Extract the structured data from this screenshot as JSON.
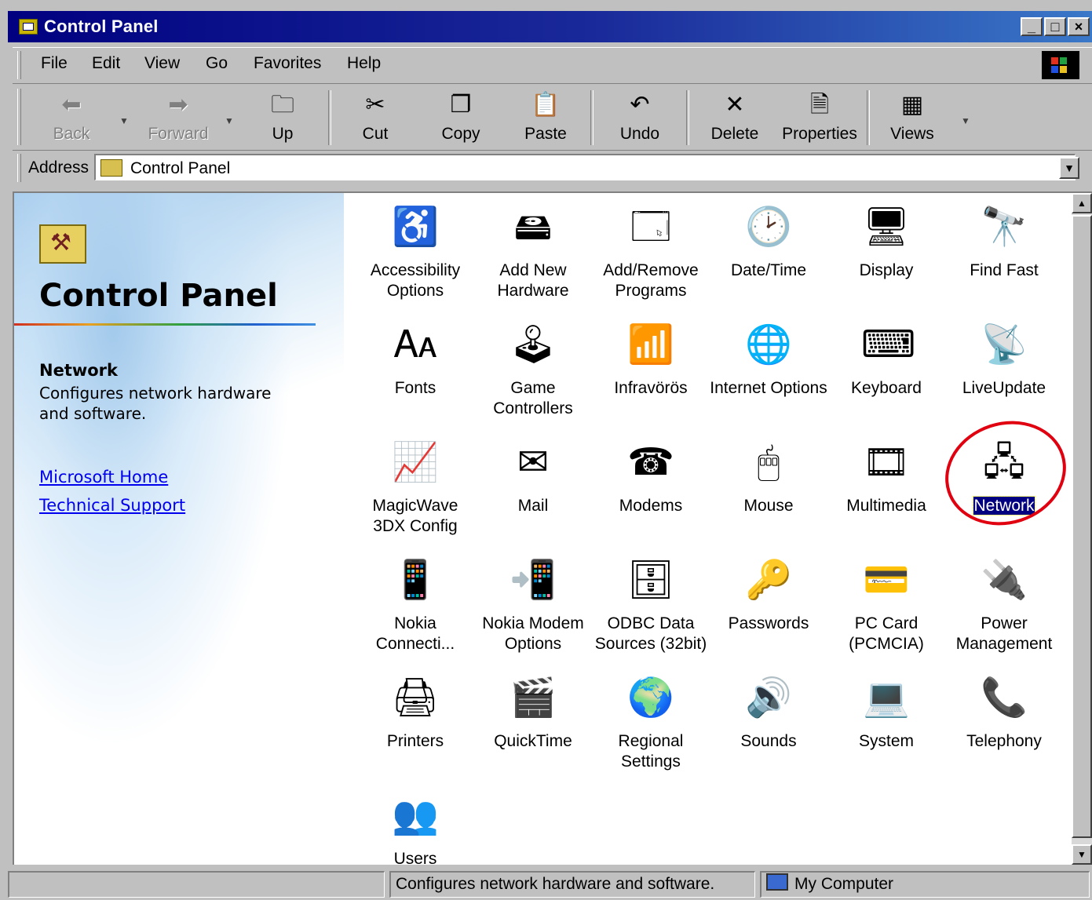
{
  "window": {
    "title": "Control Panel"
  },
  "menu": [
    "File",
    "Edit",
    "View",
    "Go",
    "Favorites",
    "Help"
  ],
  "toolbar": {
    "back": "Back",
    "forward": "Forward",
    "up": "Up",
    "cut": "Cut",
    "copy": "Copy",
    "paste": "Paste",
    "undo": "Undo",
    "delete": "Delete",
    "properties": "Properties",
    "views": "Views"
  },
  "address": {
    "label": "Address",
    "value": "Control Panel"
  },
  "webview": {
    "title": "Control Panel",
    "selected_name": "Network",
    "selected_desc": "Configures network hardware and software.",
    "links": [
      "Microsoft Home",
      "Technical Support"
    ]
  },
  "items": [
    {
      "label": "Accessibility Options",
      "icon": "accessibility-icon"
    },
    {
      "label": "Add New Hardware",
      "icon": "hardware-icon"
    },
    {
      "label": "Add/Remove Programs",
      "icon": "programs-icon"
    },
    {
      "label": "Date/Time",
      "icon": "calendar-clock-icon"
    },
    {
      "label": "Display",
      "icon": "monitor-icon"
    },
    {
      "label": "Find Fast",
      "icon": "binoculars-icon"
    },
    {
      "label": "Fonts",
      "icon": "fonts-folder-icon"
    },
    {
      "label": "Game Controllers",
      "icon": "joystick-icon"
    },
    {
      "label": "Infravörös",
      "icon": "infrared-icon"
    },
    {
      "label": "Internet Options",
      "icon": "globe-tools-icon"
    },
    {
      "label": "Keyboard",
      "icon": "keyboard-icon"
    },
    {
      "label": "LiveUpdate",
      "icon": "liveupdate-icon"
    },
    {
      "label": "MagicWave 3DX Config",
      "icon": "sound-wave-icon"
    },
    {
      "label": "Mail",
      "icon": "mail-icon"
    },
    {
      "label": "Modems",
      "icon": "telephone-icon"
    },
    {
      "label": "Mouse",
      "icon": "mouse-icon"
    },
    {
      "label": "Multimedia",
      "icon": "multimedia-icon"
    },
    {
      "label": "Network",
      "icon": "network-icon"
    },
    {
      "label": "Nokia Connecti...",
      "icon": "nokia-phone-icon"
    },
    {
      "label": "Nokia Modem Options",
      "icon": "nokia-modem-icon"
    },
    {
      "label": "ODBC Data Sources (32bit)",
      "icon": "database-icon"
    },
    {
      "label": "Passwords",
      "icon": "keys-icon"
    },
    {
      "label": "PC Card (PCMCIA)",
      "icon": "pc-card-icon"
    },
    {
      "label": "Power Management",
      "icon": "power-plug-icon"
    },
    {
      "label": "Printers",
      "icon": "printer-folder-icon"
    },
    {
      "label": "QuickTime",
      "icon": "quicktime-icon"
    },
    {
      "label": "Regional Settings",
      "icon": "globe-icon"
    },
    {
      "label": "Sounds",
      "icon": "speaker-icon"
    },
    {
      "label": "System",
      "icon": "computer-icon"
    },
    {
      "label": "Telephony",
      "icon": "telephony-icon"
    },
    {
      "label": "Users",
      "icon": "users-icon"
    }
  ],
  "selected_item": "Network",
  "status": {
    "text": "Configures network hardware and software.",
    "zone": "My Computer"
  }
}
